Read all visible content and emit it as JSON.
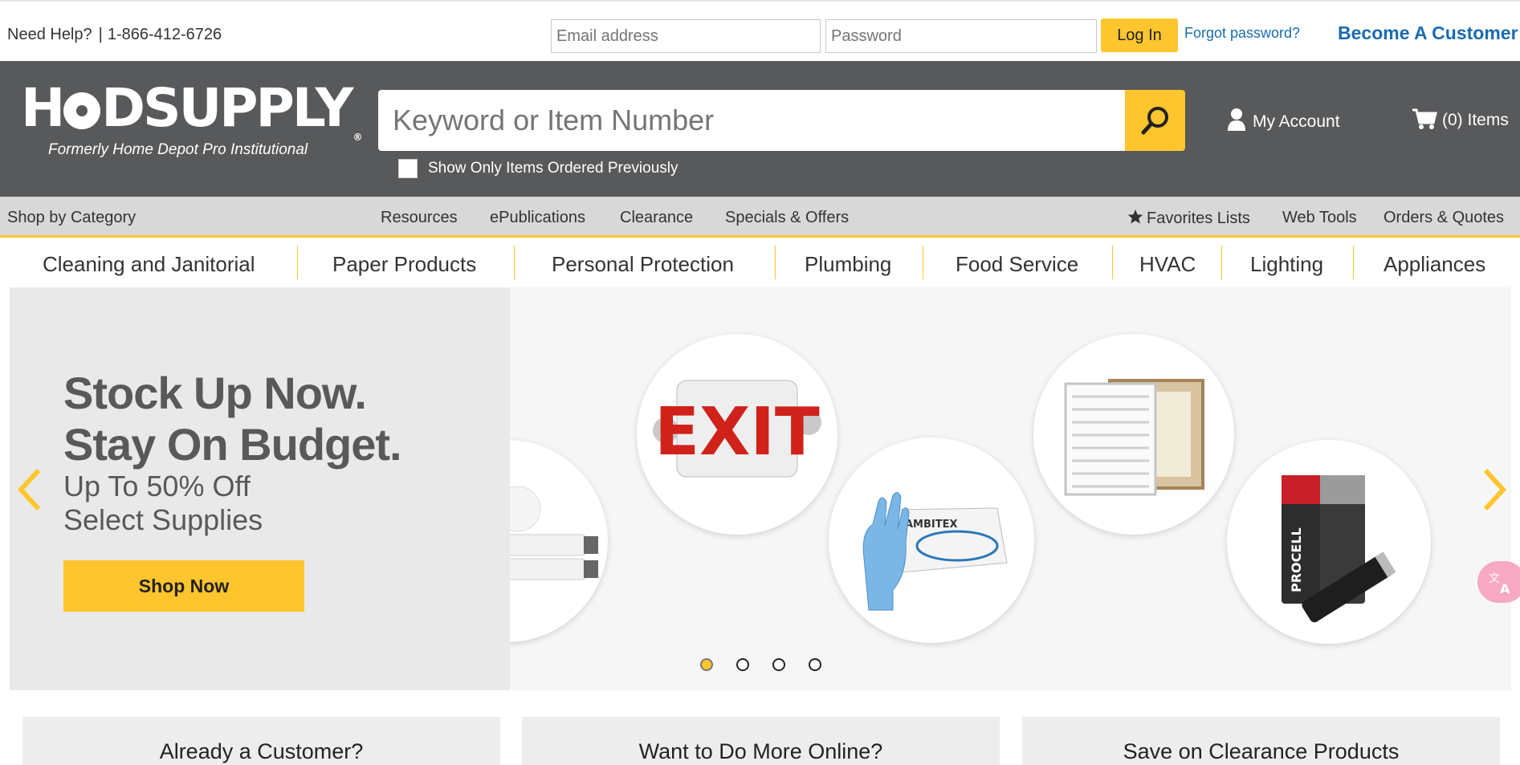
{
  "topbar": {
    "help_label": "Need Help?",
    "phone": "1-866-412-6726",
    "email_placeholder": "Email address",
    "password_placeholder": "Password",
    "login_label": "Log In",
    "forgot_label": "Forgot password?",
    "become_label": "Become A Customer"
  },
  "header": {
    "logo_left": "H",
    "logo_right": "DSUPPLY",
    "logo_reg": "®",
    "logo_tagline": "Formerly Home Depot Pro Institutional",
    "search_placeholder": "Keyword or Item Number",
    "show_previous_label": "Show Only Items Ordered Previously",
    "account_label": "My Account",
    "cart_label": "(0) Items",
    "icons": [
      "search-icon",
      "user-icon",
      "cart-icon"
    ]
  },
  "subnav": {
    "shop_by_category": "Shop by Category",
    "resources": "Resources",
    "epublications": "ePublications",
    "clearance": "Clearance",
    "specials": "Specials & Offers",
    "favorites": "Favorites Lists",
    "web_tools": "Web Tools",
    "orders": "Orders & Quotes"
  },
  "categories": [
    "Cleaning and Janitorial",
    "Paper Products",
    "Personal Protection",
    "Plumbing",
    "Food Service",
    "HVAC",
    "Lighting",
    "Appliances"
  ],
  "hero": {
    "headline_1": "Stock Up Now.",
    "headline_2": "Stay On Budget.",
    "subhead_1": "Up To 50% Off",
    "subhead_2": "Select Supplies",
    "cta_label": "Shop Now",
    "exit_sign_text": "EXIT",
    "gloves_brand": "AMBITEX",
    "battery_brand": "PROCELL",
    "slide_count": 4,
    "active_slide": 1
  },
  "cards": [
    "Already a Customer?",
    "Want to Do More Online?",
    "Save on Clearance Products"
  ],
  "colors": {
    "accent": "#fec52e",
    "header_bg": "#58595b",
    "link": "#1a6bb0"
  }
}
